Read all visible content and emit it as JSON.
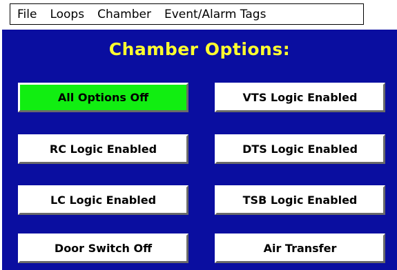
{
  "menu": {
    "items": [
      "File",
      "Loops",
      "Chamber",
      "Event/Alarm Tags"
    ]
  },
  "panel": {
    "title": "Chamber Options:",
    "options": [
      {
        "label": "All Options Off",
        "active": true
      },
      {
        "label": "VTS Logic Enabled",
        "active": false
      },
      {
        "label": "RC Logic Enabled",
        "active": false
      },
      {
        "label": "DTS Logic Enabled",
        "active": false
      },
      {
        "label": "LC Logic Enabled",
        "active": false
      },
      {
        "label": "TSB Logic Enabled",
        "active": false
      },
      {
        "label": "Door Switch Off",
        "active": false
      },
      {
        "label": "Air Transfer",
        "active": false
      }
    ]
  },
  "colors": {
    "panel_background": "#0a0ea0",
    "title_text": "#ffff2e",
    "active_option": "#11ee11",
    "option_background": "#ffffff"
  }
}
